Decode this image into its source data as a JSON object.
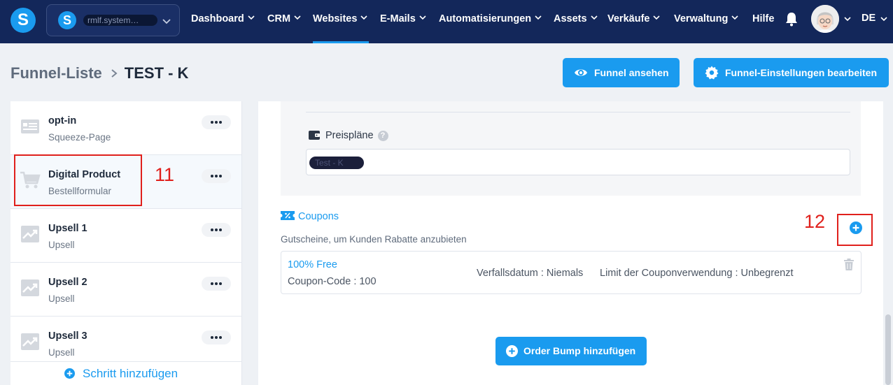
{
  "account": {
    "name": "rmlf.system…"
  },
  "nav": {
    "items": [
      {
        "label": "Dashboard",
        "has_menu": true
      },
      {
        "label": "CRM",
        "has_menu": true
      },
      {
        "label": "Websites",
        "has_menu": true,
        "active": true
      },
      {
        "label": "E-Mails",
        "has_menu": true
      },
      {
        "label": "Automatisierungen",
        "has_menu": true
      },
      {
        "label": "Assets",
        "has_menu": true
      },
      {
        "label": "Verkäufe",
        "has_menu": true
      },
      {
        "label": "Verwaltung",
        "has_menu": true
      },
      {
        "label": "Hilfe",
        "has_menu": false
      }
    ],
    "language": "DE"
  },
  "breadcrumb": {
    "parent": "Funnel-Liste",
    "current": "TEST - K"
  },
  "header_buttons": {
    "view_funnel": "Funnel ansehen",
    "edit_settings": "Funnel-Einstellungen bearbeiten"
  },
  "steps": [
    {
      "title": "opt-in",
      "subtitle": "Squeeze-Page",
      "icon": "form-icon"
    },
    {
      "title": "Digital Product",
      "subtitle": "Bestellformular",
      "icon": "cart-icon",
      "active": true
    },
    {
      "title": "Upsell 1",
      "subtitle": "Upsell",
      "icon": "chart-up-icon"
    },
    {
      "title": "Upsell 2",
      "subtitle": "Upsell",
      "icon": "chart-up-icon"
    },
    {
      "title": "Upsell 3",
      "subtitle": "Upsell",
      "icon": "chart-up-icon"
    }
  ],
  "add_step_label": "Schritt hinzufügen",
  "price_plans": {
    "label": "Preispläne",
    "help": "?",
    "selected": "Test - K"
  },
  "coupons": {
    "title": "Coupons",
    "description": "Gutscheine, um Kunden Rabatte anzubieten",
    "items": [
      {
        "name": "100% Free",
        "code": "Coupon-Code : 100",
        "expiry": "Verfallsdatum : Niemals",
        "limit": "Limit der Couponverwendung : Unbegrenzt"
      }
    ]
  },
  "order_bump_label": "Order Bump hinzufügen",
  "annotations": [
    "11",
    "12"
  ],
  "colors": {
    "nav_bg": "#13275a",
    "accent": "#1a9bef",
    "annotation": "#e0201c"
  }
}
